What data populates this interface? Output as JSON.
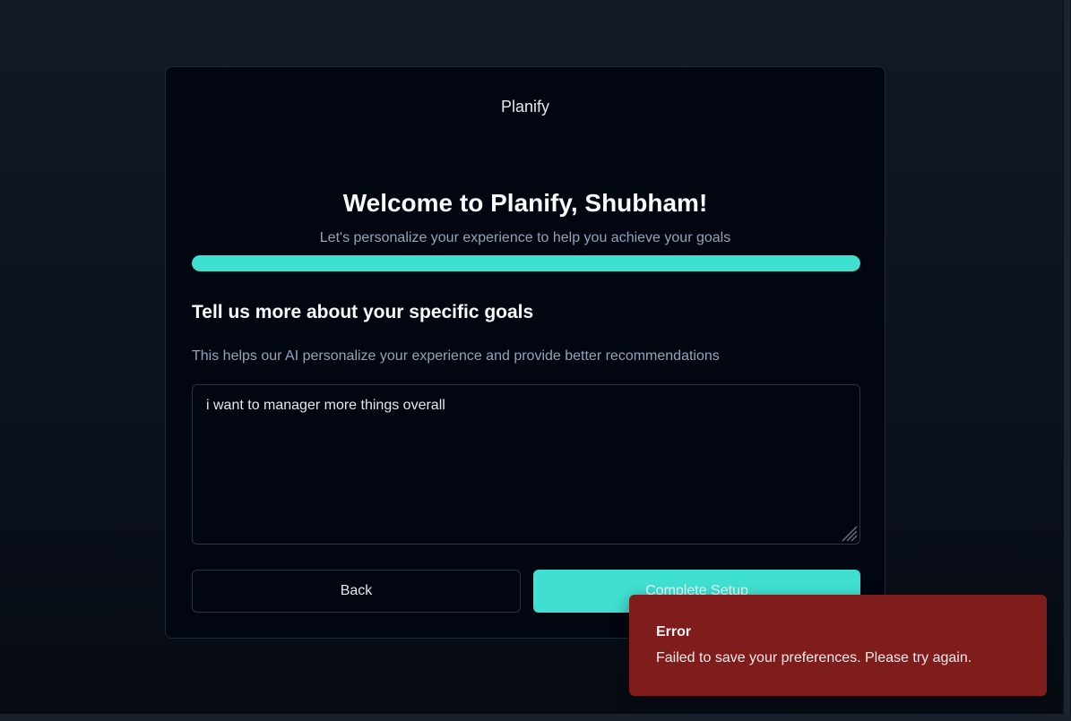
{
  "app": {
    "brand": "Planify"
  },
  "onboarding": {
    "title": "Welcome to Planify, Shubham!",
    "subtitle": "Let's personalize your experience to help you achieve your goals",
    "progress_fraction": 1.0,
    "progress_color": "#40e0d0"
  },
  "goals_step": {
    "heading": "Tell us more about your specific goals",
    "description": "This helps our AI personalize your experience and provide better recommendations",
    "input_value": "i want to manager more things overall"
  },
  "actions": {
    "back_label": "Back",
    "complete_label": "Complete Setup"
  },
  "toast": {
    "title": "Error",
    "message": "Failed to save your preferences. Please try again.",
    "background_color": "#7f1d1d"
  }
}
